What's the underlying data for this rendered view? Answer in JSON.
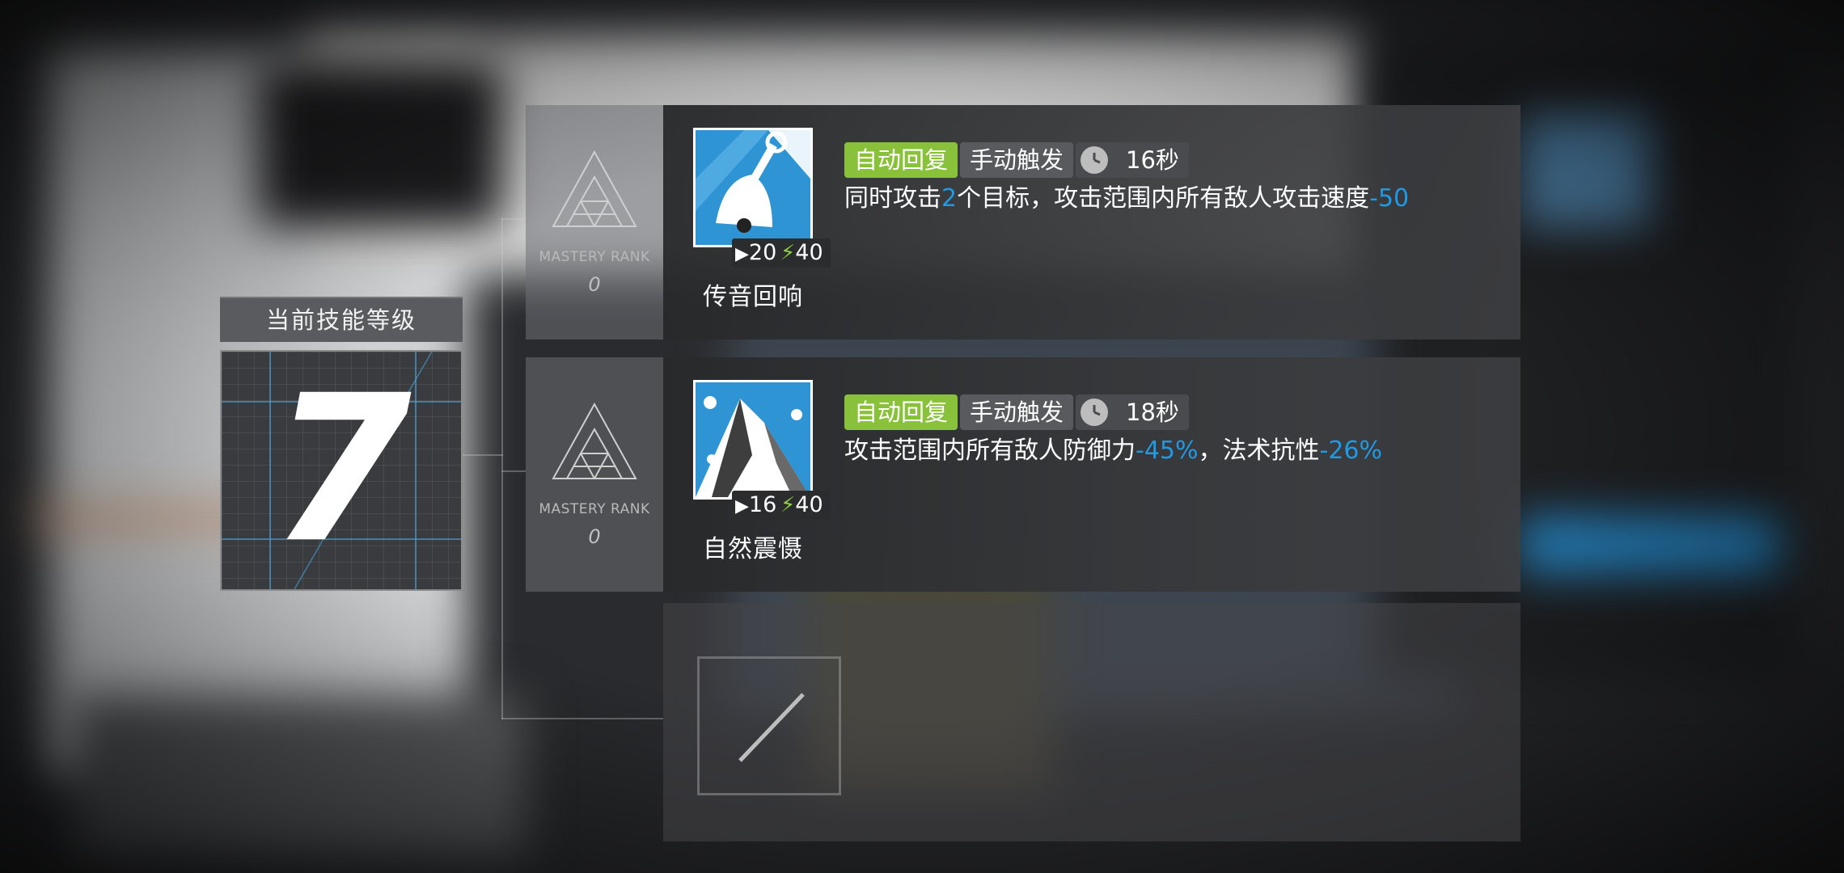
{
  "current_level": {
    "title": "当前技能等级",
    "value": "7"
  },
  "skills": [
    {
      "mastery_label": "MASTERY RANK",
      "mastery_value": "0",
      "icon": "bell-skill-icon",
      "sp_initial": "20",
      "sp_cost": "40",
      "name": "传音回响",
      "tag_recovery": "自动回复",
      "tag_activation": "手动触发",
      "duration": "16秒",
      "desc_parts": [
        "同时攻击",
        "2",
        "个目标，攻击范围内所有敌人攻击速度",
        "-50"
      ]
    },
    {
      "mastery_label": "MASTERY RANK",
      "mastery_value": "0",
      "icon": "mountain-skill-icon",
      "sp_initial": "16",
      "sp_cost": "40",
      "name": "自然震慑",
      "tag_recovery": "自动回复",
      "tag_activation": "手动触发",
      "duration": "18秒",
      "desc_parts": [
        "攻击范围内所有敌人防御力",
        "-45%",
        "，法术抗性",
        "-26%"
      ]
    }
  ],
  "colors": {
    "auto_tag": "#89c23a",
    "highlight": "#1f9ae3",
    "skill_icon_bg": "#2f94d3"
  }
}
